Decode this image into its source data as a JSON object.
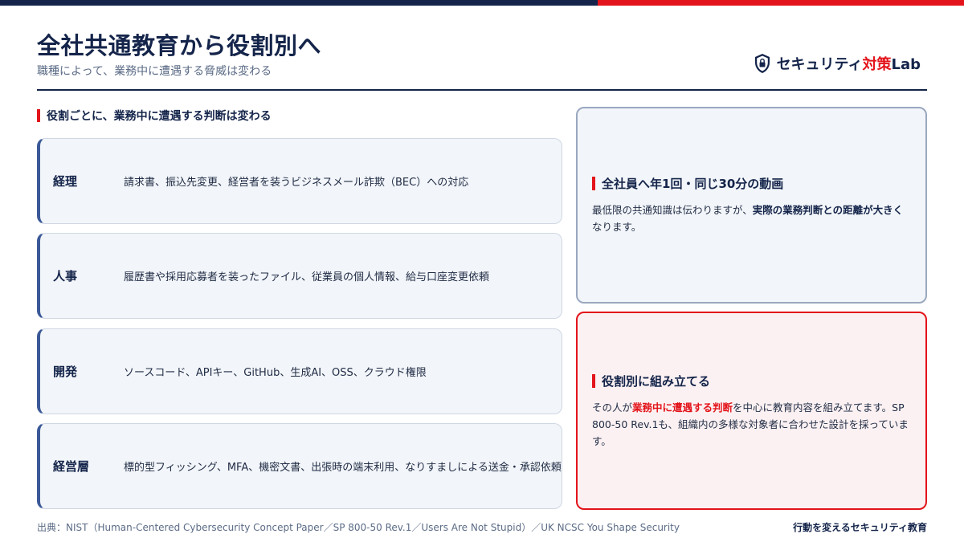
{
  "header": {
    "title": "全社共通教育から役割別へ",
    "subtitle": "職種によって、業務中に遭遇する脅威は変わる"
  },
  "brand": {
    "icon": "shield-lock-icon",
    "name_part1": "セキュリティ",
    "name_accent": "対策",
    "name_part2": "Lab"
  },
  "section": {
    "heading": "役割ごとに、業務中に遭遇する判断は変わる"
  },
  "roles": [
    {
      "name": "経理",
      "desc": "請求書、振込先変更、経営者を装うビジネスメール詐欺（BEC）への対応"
    },
    {
      "name": "人事",
      "desc": "履歴書や採用応募者を装ったファイル、従業員の個人情報、給与口座変更依頼"
    },
    {
      "name": "開発",
      "desc": "ソースコード、APIキー、GitHub、生成AI、OSS、クラウド権限"
    },
    {
      "name": "経営層",
      "desc": "標的型フィッシング、MFA、機密文書、出張時の端末利用、なりすましによる送金・承認依頼"
    }
  ],
  "panel_a": {
    "heading": "全社員へ年1回・同じ30分の動画",
    "body_pre": "最低限の共通知識は伝わりますが、",
    "body_bold": "実際の業務判断との距離が大きく",
    "body_post": "なります。"
  },
  "panel_b": {
    "heading": "役割別に組み立てる",
    "body_pre": "その人が",
    "body_red": "業務中に遭遇する判断",
    "body_post": "を中心に教育内容を組み立てます。SP 800-50 Rev.1も、組織内の多様な対象者に合わせた設計を採っています。"
  },
  "footer": {
    "source": "出典：NIST（Human-Centered Cybersecurity Concept Paper／SP 800-50 Rev.1／Users Are Not Stupid）／UK NCSC You Shape Security",
    "tagline": "行動を変えるセキュリティ教育"
  },
  "colors": {
    "navy": "#14244a",
    "accent_red": "#e3141b",
    "card_bg": "#f2f5f9",
    "card_border_left": "#3b5998",
    "panel_red_bg": "#fbf1f2"
  }
}
